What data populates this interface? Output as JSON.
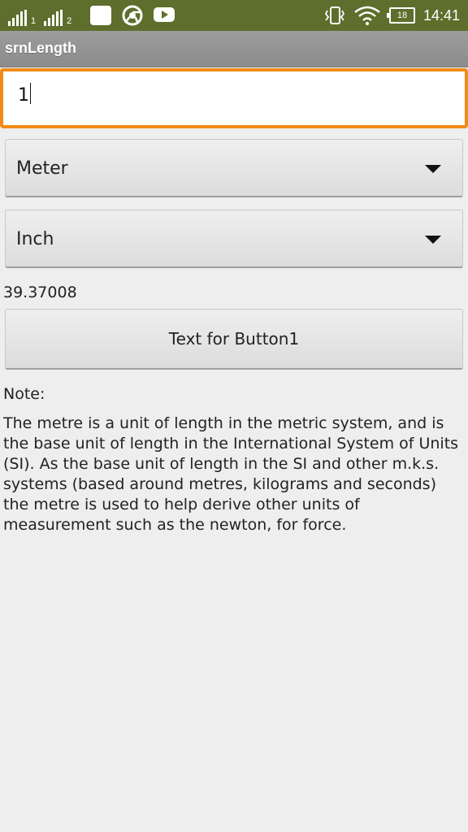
{
  "status_bar": {
    "sim1_label": "1",
    "sim2_label": "2",
    "battery_level": "18",
    "time": "14:41",
    "background_color": "#5e6e2c",
    "icons": [
      "signal-icon",
      "signal-icon",
      "gallery-icon",
      "chrome-icon",
      "youtube-icon",
      "vibrate-icon",
      "wifi-icon",
      "battery-icon"
    ]
  },
  "app": {
    "title": "srnLength"
  },
  "input": {
    "value": "1",
    "focus_color": "#f28b1a"
  },
  "from_unit": {
    "selected": "Meter"
  },
  "to_unit": {
    "selected": "Inch"
  },
  "result": {
    "value": "39.37008"
  },
  "button": {
    "label": "Text for Button1"
  },
  "note": {
    "label": "Note:",
    "text": "The metre is a unit of length in the metric system, and is the base unit of length in the International System of Units (SI). As the base unit of length in the SI and other m.k.s. systems (based around metres, kilograms and seconds) the metre is used to help derive other units of measurement such as the newton, for force."
  }
}
